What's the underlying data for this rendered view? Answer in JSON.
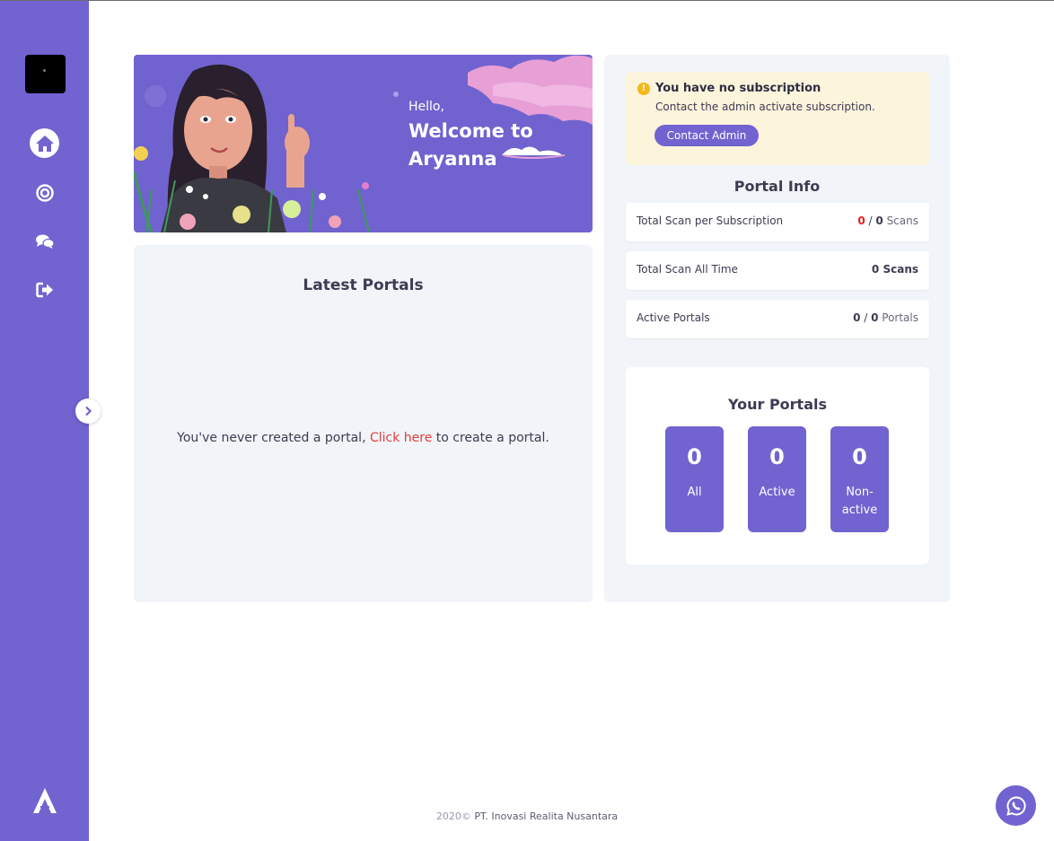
{
  "colors": {
    "accent": "#7163d0",
    "panel_bg": "#f1f4f8",
    "alert_bg": "#fdf4dc",
    "link_red": "#e53b3b"
  },
  "sidebar": {
    "items": [
      {
        "icon": "home-icon",
        "active": true
      },
      {
        "icon": "target-icon",
        "active": false
      },
      {
        "icon": "chat-icon",
        "active": false
      },
      {
        "icon": "logout-icon",
        "active": false
      }
    ]
  },
  "banner": {
    "hello": "Hello,",
    "title": "Welcome to\nAryanna"
  },
  "latest": {
    "title": "Latest Portals",
    "empty_prefix": "You've never created a portal, ",
    "empty_link": "Click here",
    "empty_suffix": " to create a portal."
  },
  "subscription": {
    "title": "You have no subscription",
    "text": "Contact the admin activate subscription.",
    "button": "Contact Admin"
  },
  "portal_info": {
    "title": "Portal Info",
    "rows": [
      {
        "label": "Total Scan per Subscription",
        "used": "0",
        "sep": " / ",
        "total": "0",
        "unit": " Scans"
      },
      {
        "label": "Total Scan All Time",
        "value": "0",
        "unit": " Scans"
      },
      {
        "label": "Active Portals",
        "used": "0",
        "sep": " / ",
        "total": "0",
        "unit": " Portals"
      }
    ]
  },
  "your_portals": {
    "title": "Your Portals",
    "tiles": [
      {
        "count": "0",
        "label": "All"
      },
      {
        "count": "0",
        "label": "Active"
      },
      {
        "count": "0",
        "label": "Non-\nactive"
      }
    ]
  },
  "footer": {
    "year": "2020©",
    "company": " PT. Inovasi Realita Nusantara"
  }
}
